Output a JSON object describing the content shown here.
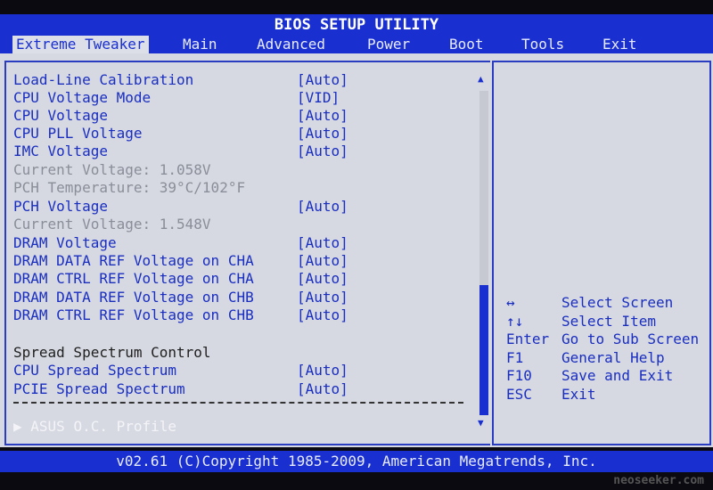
{
  "title": "BIOS SETUP UTILITY",
  "tabs": [
    {
      "label": "Extreme Tweaker",
      "selected": true
    },
    {
      "label": "Main"
    },
    {
      "label": "Advanced"
    },
    {
      "label": "Power"
    },
    {
      "label": "Boot"
    },
    {
      "label": "Tools"
    },
    {
      "label": "Exit"
    }
  ],
  "items": [
    {
      "label": "Load-Line Calibration",
      "value": "[Auto]",
      "type": "option"
    },
    {
      "label": "CPU Voltage Mode",
      "value": "[VID]",
      "type": "option"
    },
    {
      "label": "CPU Voltage",
      "value": "[Auto]",
      "type": "option"
    },
    {
      "label": "CPU PLL Voltage",
      "value": "[Auto]",
      "type": "option"
    },
    {
      "label": "IMC Voltage",
      "value": "[Auto]",
      "type": "option"
    },
    {
      "label": "Current Voltage: 1.058V",
      "type": "info"
    },
    {
      "label": "PCH Temperature: 39°C/102°F",
      "type": "info"
    },
    {
      "label": "PCH Voltage",
      "value": "[Auto]",
      "type": "option"
    },
    {
      "label": "Current Voltage: 1.548V",
      "type": "info"
    },
    {
      "label": "DRAM Voltage",
      "value": "[Auto]",
      "type": "option"
    },
    {
      "label": "DRAM DATA REF Voltage on CHA",
      "value": "[Auto]",
      "type": "option"
    },
    {
      "label": "DRAM CTRL REF Voltage on CHA",
      "value": "[Auto]",
      "type": "option"
    },
    {
      "label": "DRAM DATA REF Voltage on CHB",
      "value": "[Auto]",
      "type": "option"
    },
    {
      "label": "DRAM CTRL REF Voltage on CHB",
      "value": "[Auto]",
      "type": "option"
    },
    {
      "label": "Spread Spectrum Control",
      "type": "heading"
    },
    {
      "label": "CPU Spread Spectrum",
      "value": "[Auto]",
      "type": "option"
    },
    {
      "label": "PCIE Spread Spectrum",
      "value": "[Auto]",
      "type": "option"
    }
  ],
  "submenu": {
    "arrow": "▶",
    "label": "ASUS O.C. Profile"
  },
  "scroll": {
    "up": "▲",
    "down": "▼",
    "thumb_start": 0.6,
    "thumb_end": 1.0
  },
  "help": [
    {
      "key": "↔",
      "desc": "Select Screen"
    },
    {
      "key": "↑↓",
      "desc": "Select Item"
    },
    {
      "key": "Enter",
      "desc": "Go to Sub Screen"
    },
    {
      "key": "F1",
      "desc": "General Help"
    },
    {
      "key": "F10",
      "desc": "Save and Exit"
    },
    {
      "key": "ESC",
      "desc": "Exit"
    }
  ],
  "footer": "v02.61 (C)Copyright 1985-2009, American Megatrends, Inc.",
  "watermark": "neoseeker.com"
}
